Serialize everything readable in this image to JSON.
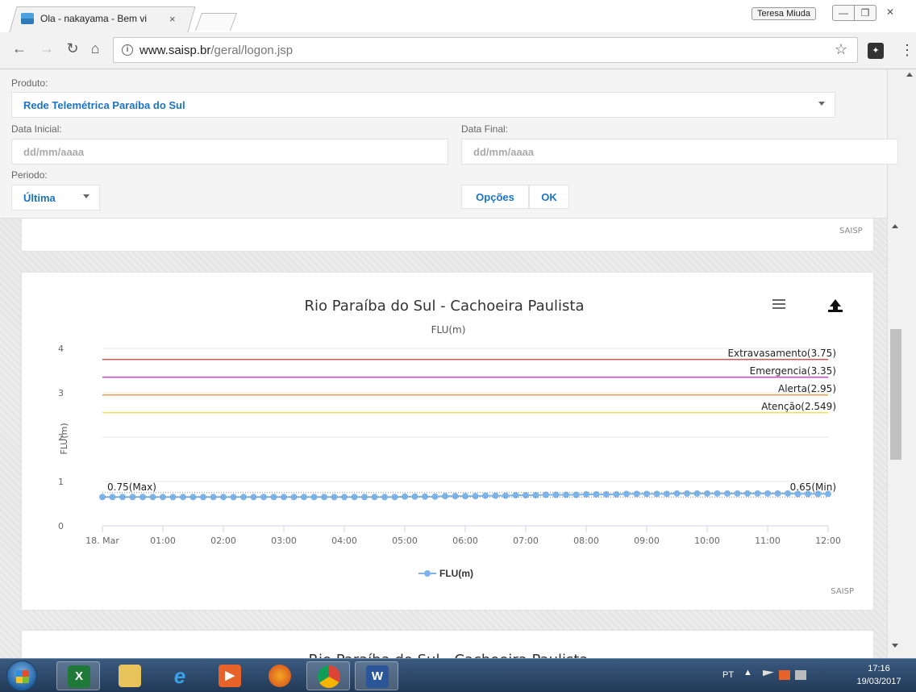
{
  "browser": {
    "tab_title": "Ola - nakayama - Bem vi",
    "tab_close": "×",
    "profile_name": "Teresa Miuda",
    "url_host": "www.saisp.br",
    "url_path": "/geral/logon.jsp",
    "window_controls": {
      "minimize": "—",
      "maximize": "❐",
      "close": "✕"
    }
  },
  "form": {
    "produto_label": "Produto:",
    "produto_value": "Rede Telemétrica Paraíba do Sul",
    "data_inicial_label": "Data Inicial:",
    "data_inicial_placeholder": "dd/mm/aaaa",
    "data_final_label": "Data Final:",
    "data_final_placeholder": "dd/mm/aaaa",
    "periodo_label": "Periodo:",
    "periodo_value": "Última",
    "opcoes_label": "Opções",
    "ok_label": "OK"
  },
  "cards": {
    "credit_top": "SAISP",
    "credit_main": "SAISP",
    "next_title": "Rio Paraíba do Sul - Cachoeira Paulista"
  },
  "chart_data": {
    "type": "line",
    "title": "Rio Paraíba do Sul - Cachoeira Paulista",
    "subtitle": "FLU(m)",
    "xlabel": "",
    "ylabel": "FLU(m)",
    "ylim": [
      0,
      4
    ],
    "y_ticks": [
      "0",
      "1",
      "2",
      "3",
      "4"
    ],
    "x_ticks": [
      "18. Mar",
      "01:00",
      "02:00",
      "03:00",
      "04:00",
      "05:00",
      "06:00",
      "07:00",
      "08:00",
      "09:00",
      "10:00",
      "11:00",
      "12:00"
    ],
    "x_range_hours": [
      0,
      12
    ],
    "thresholds": [
      {
        "label": "Extravasamento(3.75)",
        "value": 3.75,
        "color": "#e8302a"
      },
      {
        "label": "Emergencia(3.35)",
        "value": 3.35,
        "color": "#d21fd2"
      },
      {
        "label": "Alerta(2.95)",
        "value": 2.95,
        "color": "#f08a24"
      },
      {
        "label": "Atenção(2.549)",
        "value": 2.549,
        "color": "#f2d21c"
      }
    ],
    "max_label": "0.75(Max)",
    "min_label": "0.65(Min)",
    "max_value": 0.75,
    "min_value": 0.65,
    "series": [
      {
        "name": "FLU(m)",
        "color": "#7cb5ec",
        "step_minutes": 10,
        "values": [
          0.65,
          0.65,
          0.65,
          0.65,
          0.65,
          0.65,
          0.65,
          0.65,
          0.65,
          0.65,
          0.65,
          0.65,
          0.65,
          0.65,
          0.65,
          0.65,
          0.65,
          0.65,
          0.65,
          0.65,
          0.65,
          0.65,
          0.65,
          0.65,
          0.65,
          0.65,
          0.65,
          0.65,
          0.65,
          0.65,
          0.66,
          0.66,
          0.66,
          0.66,
          0.67,
          0.67,
          0.67,
          0.67,
          0.68,
          0.68,
          0.68,
          0.69,
          0.69,
          0.69,
          0.7,
          0.7,
          0.7,
          0.7,
          0.71,
          0.71,
          0.71,
          0.71,
          0.72,
          0.72,
          0.72,
          0.72,
          0.72,
          0.73,
          0.73,
          0.73,
          0.73,
          0.73,
          0.73,
          0.73,
          0.73,
          0.73,
          0.73,
          0.73,
          0.73,
          0.72,
          0.72,
          0.72,
          0.72
        ]
      }
    ],
    "legend": "bottom-center",
    "credit": "SAISP"
  },
  "taskbar": {
    "lang": "PT",
    "time": "17:16",
    "date": "19/03/2017"
  }
}
